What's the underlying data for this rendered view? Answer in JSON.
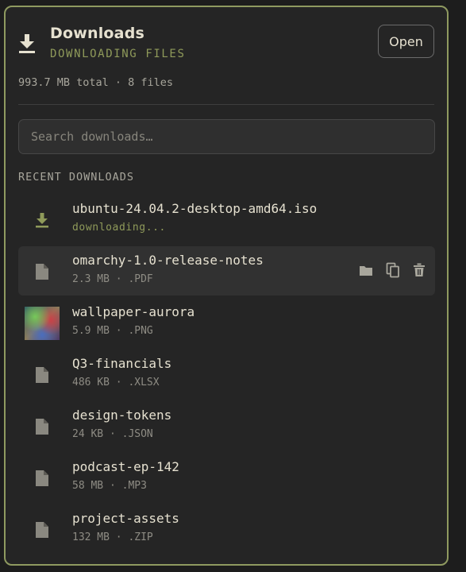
{
  "header": {
    "title": "Downloads",
    "subtitle": "DOWNLOADING FILES",
    "open_label": "Open",
    "icon": "download-icon"
  },
  "summary": "993.7 MB total · 8 files",
  "search": {
    "placeholder": "Search downloads…",
    "value": ""
  },
  "section_label": "RECENT DOWNLOADS",
  "colors": {
    "accent": "#8f9a5a",
    "border": "#8f9a60",
    "panel": "#252525",
    "text": "#e6e1d0",
    "muted": "#8e8c84"
  },
  "items": [
    {
      "name": "ubuntu-24.04.2-desktop-amd64.iso",
      "meta": "downloading...",
      "icon": "download-icon",
      "status": "downloading"
    },
    {
      "name": "omarchy-1.0-release-notes",
      "meta": "2.3 MB · .PDF",
      "icon": "file-icon",
      "hovered": true,
      "actions": [
        "folder-icon",
        "copy-icon",
        "trash-icon"
      ]
    },
    {
      "name": "wallpaper-aurora",
      "meta": "5.9 MB · .PNG",
      "icon": "image-thumbnail"
    },
    {
      "name": "Q3-financials",
      "meta": "486 KB · .XLSX",
      "icon": "file-icon"
    },
    {
      "name": "design-tokens",
      "meta": "24 KB · .JSON",
      "icon": "file-icon"
    },
    {
      "name": "podcast-ep-142",
      "meta": "58 MB · .MP3",
      "icon": "file-icon"
    },
    {
      "name": "project-assets",
      "meta": "132 MB · .ZIP",
      "icon": "file-icon"
    }
  ]
}
